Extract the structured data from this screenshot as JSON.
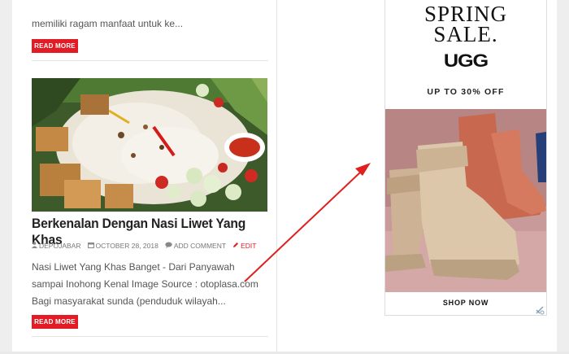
{
  "feed": {
    "prev_post": {
      "excerpt": "memiliki ragam manfaat untuk ke...",
      "read_more_label": "READ MORE"
    },
    "post": {
      "title": "Berkenalan Dengan Nasi Liwet Yang Khas",
      "meta": {
        "author": "DEPOJABAR",
        "date": "OCTOBER 28, 2018",
        "comment": "ADD COMMENT",
        "edit": "EDIT"
      },
      "excerpt": "Nasi Liwet Yang Khas Banget - Dari Panyawah sampai Inohong Kenal Image Source : otoplasa.com Bagi masyarakat sunda (penduduk wilayah...",
      "read_more_label": "READ MORE"
    }
  },
  "ad": {
    "headline_line1": "SPRING",
    "headline_line2": "SALE.",
    "brand": "UGG",
    "offer": "UP TO 30% OFF",
    "cta": "SHOP NOW"
  },
  "icons": {
    "author": "user-icon",
    "date": "calendar-icon",
    "comment": "comment-icon",
    "edit": "pencil-icon",
    "adchoices": "adchoices-icon"
  },
  "colors": {
    "accent": "#e21b24",
    "annotation_arrow": "#e0201f"
  }
}
